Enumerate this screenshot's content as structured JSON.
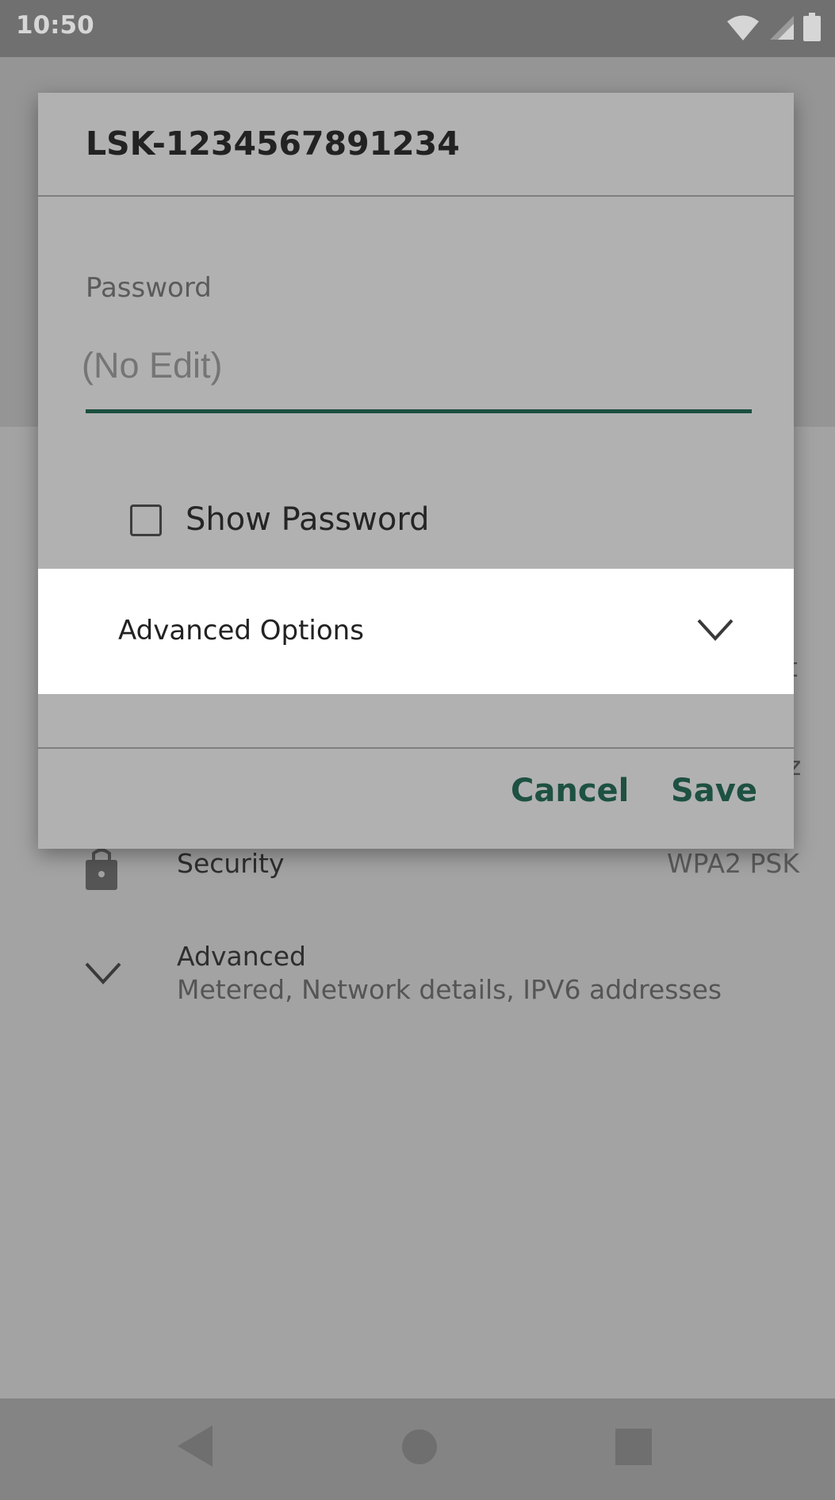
{
  "status_bar": {
    "time": "10:50",
    "icons": [
      "wifi-icon",
      "signal-icon",
      "battery-icon"
    ]
  },
  "background": {
    "rows": [
      {
        "label": "Security",
        "value": "WPA2 PSK",
        "icon": "lock-icon"
      },
      {
        "label": "Advanced",
        "sublabel": "Metered, Network details, IPV6 addresses",
        "icon": "chevron-down-icon"
      }
    ],
    "edge_glyphs": [
      "t",
      "z"
    ]
  },
  "dialog": {
    "title": "LSK-1234567891234",
    "password_label": "Password",
    "password_placeholder": "(No Edit)",
    "show_password_label": "Show Password",
    "show_password_checked": false,
    "advanced_options_label": "Advanced Options",
    "cancel_label": "Cancel",
    "save_label": "Save"
  },
  "nav_bar": {
    "buttons": [
      "back-icon",
      "home-icon",
      "recents-icon"
    ]
  },
  "colors": {
    "accent": "#1d5141",
    "scrim": "#a3a3a3",
    "dialog_bg": "#b1b1b1"
  }
}
